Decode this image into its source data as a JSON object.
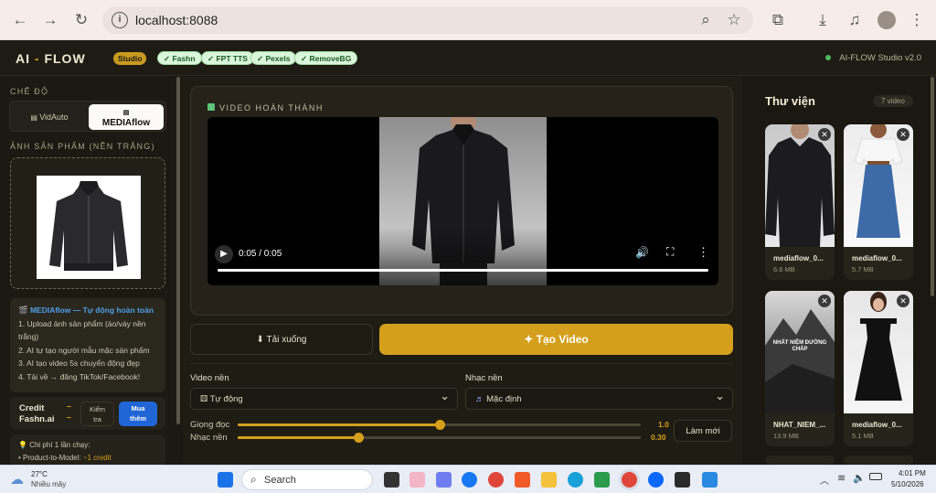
{
  "browser": {
    "url": "localhost:8088"
  },
  "header": {
    "logo_prefix": "AI",
    "logo_dash": " - ",
    "logo_suffix": "FLOW",
    "badge": "Studio",
    "chips": [
      "✓ Fashn",
      "✓ FPT TTS",
      "✓ Pexels",
      "✓ RemoveBG"
    ],
    "version": "AI-FLOW Studio v2.0"
  },
  "sidebar": {
    "mode_heading": "CHẾ ĐỘ",
    "modes": [
      "VidAuto",
      "MEDIAflow"
    ],
    "product_heading": "ẢNH SẢN PHẨM (NỀN TRẮNG)",
    "info_title": "MEDIAflow — Tự động hoàn toàn",
    "info_steps": [
      "1. Upload ảnh sản phẩm (áo/váy nền",
      "trắng)",
      "2. AI tự tạo người mẫu mặc sản phẩm",
      "3. AI tạo video 5s chuyển động đẹp",
      "4. Tải về → đăng TikTok/Facebook!"
    ],
    "credit_label_1": "Credit",
    "credit_label_2": "Fashn.ai",
    "credit_value": "–",
    "check_button_1": "Kiểm",
    "check_button_2": "tra",
    "buy_button_1": "Mua",
    "buy_button_2": "thêm",
    "cost_title": "Chi phí 1 lần chạy:",
    "cost_line_prefix": "• Product-to-Model: ",
    "cost_line_value": "~1 credit"
  },
  "main": {
    "status": "VIDEO HOÀN THÀNH",
    "time": "0:05 / 0:05",
    "download": "⬇ Tải xuống",
    "create": "✦ Tạo Video",
    "bg_video_label": "Video nền",
    "bg_video_value": "Tự động",
    "bg_music_label": "Nhạc nền",
    "bg_music_value": "Mặc định",
    "voice_label": "Giọng đọc",
    "voice_value": "1.0",
    "voice_level": 0.5,
    "music_label": "Nhạc nền",
    "music_value": "0.30",
    "music_level": 0.3,
    "reset": "Làm mới"
  },
  "library": {
    "title": "Thư viện",
    "count": "7 video",
    "items": [
      {
        "name": "mediaflow_0...",
        "size": "6.6 MB"
      },
      {
        "name": "mediaflow_0...",
        "size": "5.7 MB"
      },
      {
        "name": "NHAT_NIEM_...",
        "size": "13.9 MB"
      },
      {
        "name": "mediaflow_0...",
        "size": "5.1 MB"
      }
    ],
    "thumb3_text_1": "NHẤT NIỆM ĐƯỜNG",
    "thumb3_text_2": "CHẤP"
  },
  "taskbar": {
    "weather_temp": "27°C",
    "weather_desc": "Nhiều mây",
    "search": "Search",
    "time": "4:01 PM",
    "date": "5/10/2026"
  }
}
